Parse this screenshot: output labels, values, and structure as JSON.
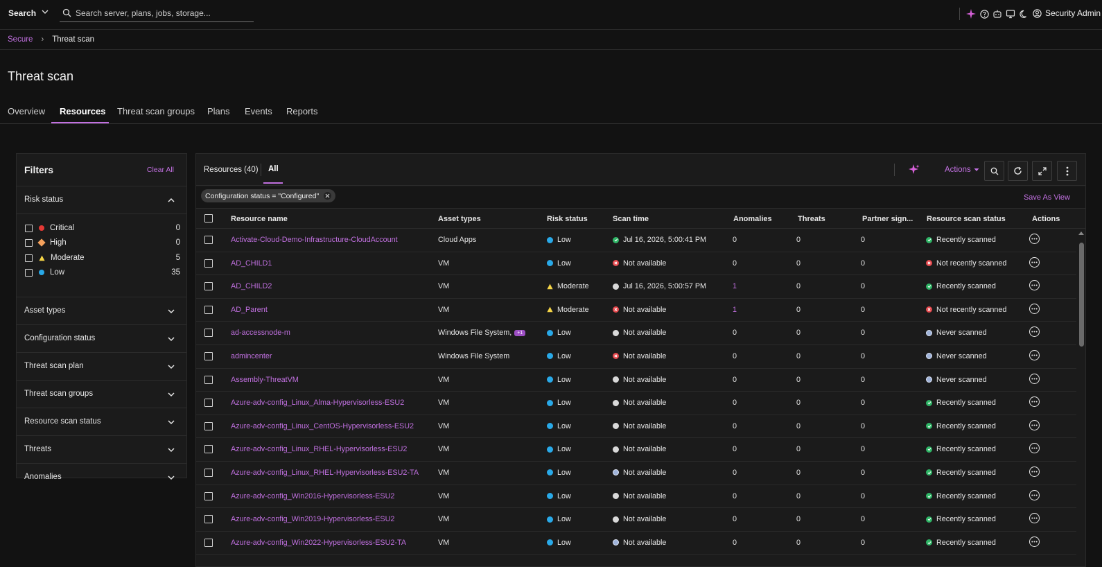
{
  "topbar": {
    "search_mode": "Search",
    "search_placeholder": "Search server, plans, jobs, storage...",
    "user_name": "Security Admin"
  },
  "breadcrumb": {
    "parent": "Secure",
    "current": "Threat scan"
  },
  "page": {
    "title": "Threat scan"
  },
  "tabs": [
    "Overview",
    "Resources",
    "Threat scan groups",
    "Plans",
    "Events",
    "Reports"
  ],
  "filters": {
    "title": "Filters",
    "clear_all": "Clear All",
    "risk_status": {
      "label": "Risk status",
      "items": [
        {
          "label": "Critical",
          "count": "0"
        },
        {
          "label": "High",
          "count": "0"
        },
        {
          "label": "Moderate",
          "count": "5"
        },
        {
          "label": "Low",
          "count": "35"
        }
      ]
    },
    "sections": [
      "Asset types",
      "Configuration status",
      "Threat scan plan",
      "Threat scan groups",
      "Resource scan status",
      "Threats",
      "Anomalies"
    ]
  },
  "panel": {
    "resources_count": "Resources (40)",
    "view_all": "All",
    "actions_label": "Actions",
    "chip": "Configuration status = \"Configured\"",
    "save_as_view": "Save As View"
  },
  "columns": [
    "Resource name",
    "Asset types",
    "Risk status",
    "Scan time",
    "Anomalies",
    "Threats",
    "Partner sign...",
    "Resource scan status",
    "Actions"
  ],
  "rows": [
    {
      "name": "Activate-Cloud-Demo-Infrastructure-CloudAccount",
      "asset": "Cloud Apps",
      "asset_extra": "",
      "risk": "Low",
      "scan_icon": "success",
      "scan": "Jul 16, 2026, 5:00:41 PM",
      "anomalies": "0",
      "threats": "0",
      "partner": "0",
      "rss_icon": "success",
      "rss": "Recently scanned"
    },
    {
      "name": "AD_CHILD1",
      "asset": "VM",
      "asset_extra": "",
      "risk": "Low",
      "scan_icon": "error",
      "scan": "Not available",
      "anomalies": "0",
      "threats": "0",
      "partner": "0",
      "rss_icon": "error",
      "rss": "Not recently scanned"
    },
    {
      "name": "AD_CHILD2",
      "asset": "VM",
      "asset_extra": "",
      "risk": "Moderate",
      "scan_icon": "neutral",
      "scan": "Jul 16, 2026, 5:00:57 PM",
      "anomalies": "1",
      "threats": "0",
      "partner": "0",
      "rss_icon": "success",
      "rss": "Recently scanned"
    },
    {
      "name": "AD_Parent",
      "asset": "VM",
      "asset_extra": "",
      "risk": "Moderate",
      "scan_icon": "error",
      "scan": "Not available",
      "anomalies": "1",
      "threats": "0",
      "partner": "0",
      "rss_icon": "error",
      "rss": "Not recently scanned"
    },
    {
      "name": "ad-accessnode-m",
      "asset": "Windows File System,",
      "asset_extra": "+1",
      "risk": "Low",
      "scan_icon": "neutral",
      "scan": "Not available",
      "anomalies": "0",
      "threats": "0",
      "partner": "0",
      "rss_icon": "never",
      "rss": "Never scanned"
    },
    {
      "name": "admincenter",
      "asset": "Windows File System",
      "asset_extra": "",
      "risk": "Low",
      "scan_icon": "error",
      "scan": "Not available",
      "anomalies": "0",
      "threats": "0",
      "partner": "0",
      "rss_icon": "never",
      "rss": "Never scanned"
    },
    {
      "name": "Assembly-ThreatVM",
      "asset": "VM",
      "asset_extra": "",
      "risk": "Low",
      "scan_icon": "neutral",
      "scan": "Not available",
      "anomalies": "0",
      "threats": "0",
      "partner": "0",
      "rss_icon": "never",
      "rss": "Never scanned"
    },
    {
      "name": "Azure-adv-config_Linux_Alma-Hypervisorless-ESU2",
      "asset": "VM",
      "asset_extra": "",
      "risk": "Low",
      "scan_icon": "neutral",
      "scan": "Not available",
      "anomalies": "0",
      "threats": "0",
      "partner": "0",
      "rss_icon": "success",
      "rss": "Recently scanned"
    },
    {
      "name": "Azure-adv-config_Linux_CentOS-Hypervisorless-ESU2",
      "asset": "VM",
      "asset_extra": "",
      "risk": "Low",
      "scan_icon": "neutral",
      "scan": "Not available",
      "anomalies": "0",
      "threats": "0",
      "partner": "0",
      "rss_icon": "success",
      "rss": "Recently scanned"
    },
    {
      "name": "Azure-adv-config_Linux_RHEL-Hypervisorless-ESU2",
      "asset": "VM",
      "asset_extra": "",
      "risk": "Low",
      "scan_icon": "neutral",
      "scan": "Not available",
      "anomalies": "0",
      "threats": "0",
      "partner": "0",
      "rss_icon": "success",
      "rss": "Recently scanned"
    },
    {
      "name": "Azure-adv-config_Linux_RHEL-Hypervisorless-ESU2-TA",
      "asset": "VM",
      "asset_extra": "",
      "risk": "Low",
      "scan_icon": "never",
      "scan": "Not available",
      "anomalies": "0",
      "threats": "0",
      "partner": "0",
      "rss_icon": "success",
      "rss": "Recently scanned"
    },
    {
      "name": "Azure-adv-config_Win2016-Hypervisorless-ESU2",
      "asset": "VM",
      "asset_extra": "",
      "risk": "Low",
      "scan_icon": "neutral",
      "scan": "Not available",
      "anomalies": "0",
      "threats": "0",
      "partner": "0",
      "rss_icon": "success",
      "rss": "Recently scanned"
    },
    {
      "name": "Azure-adv-config_Win2019-Hypervisorless-ESU2",
      "asset": "VM",
      "asset_extra": "",
      "risk": "Low",
      "scan_icon": "neutral",
      "scan": "Not available",
      "anomalies": "0",
      "threats": "0",
      "partner": "0",
      "rss_icon": "success",
      "rss": "Recently scanned"
    },
    {
      "name": "Azure-adv-config_Win2022-Hypervisorless-ESU2-TA",
      "asset": "VM",
      "asset_extra": "",
      "risk": "Low",
      "scan_icon": "never",
      "scan": "Not available",
      "anomalies": "0",
      "threats": "0",
      "partner": "0",
      "rss_icon": "success",
      "rss": "Recently scanned"
    }
  ],
  "colors": {
    "accent": "#c170e0",
    "critical": "#e53935",
    "high": "#f5a25d",
    "moderate": "#f5d547",
    "low": "#29a9e8",
    "success": "#2fb566",
    "error": "#e5484d",
    "neutral": "#d9d9d9"
  },
  "icons": [
    "search-icon",
    "chevron-down-icon",
    "sparkle-icon",
    "help-icon",
    "monitor-icon",
    "moon-icon",
    "user-icon",
    "refresh-icon",
    "expand-icon",
    "kebab-icon"
  ]
}
